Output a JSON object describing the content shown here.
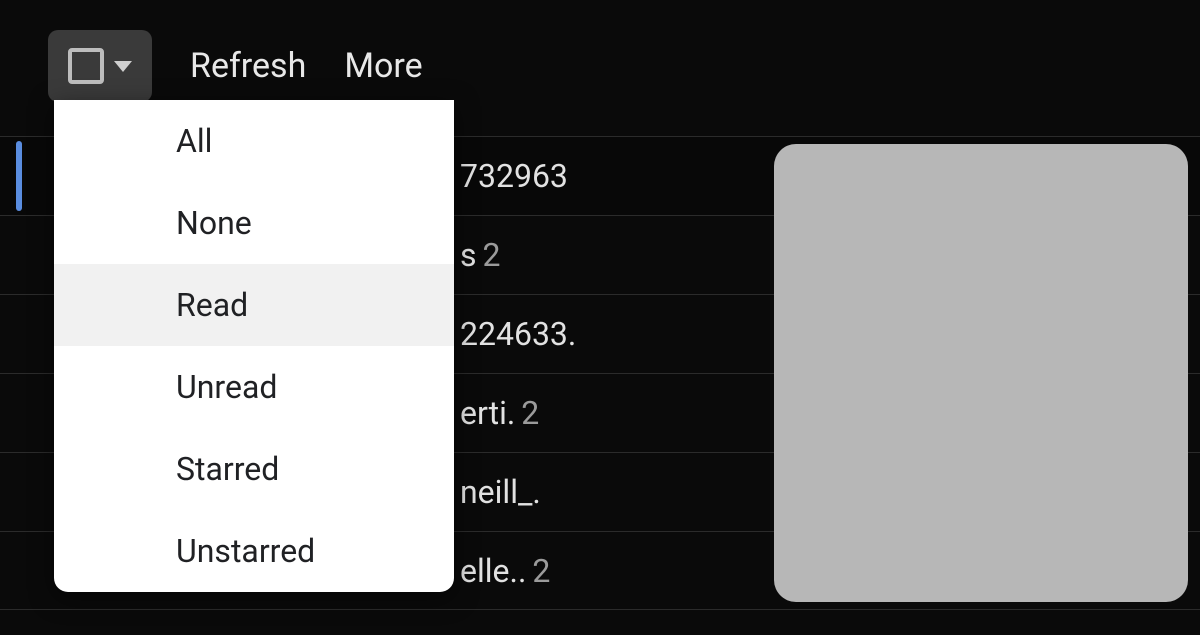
{
  "toolbar": {
    "refresh_label": "Refresh",
    "more_label": "More"
  },
  "select_menu": {
    "items": [
      {
        "label": "All"
      },
      {
        "label": "None"
      },
      {
        "label": "Read"
      },
      {
        "label": "Unread"
      },
      {
        "label": "Starred"
      },
      {
        "label": "Unstarred"
      }
    ],
    "hovered_index": 2
  },
  "messages": [
    {
      "text_fragment": "732963",
      "count": null
    },
    {
      "text_fragment": "s",
      "count": "2"
    },
    {
      "text_fragment": "224633.",
      "count": null
    },
    {
      "text_fragment": "erti.",
      "count": "2"
    },
    {
      "text_fragment": "neill_.",
      "count": null
    },
    {
      "text_fragment": "elle..",
      "count": "2"
    }
  ]
}
